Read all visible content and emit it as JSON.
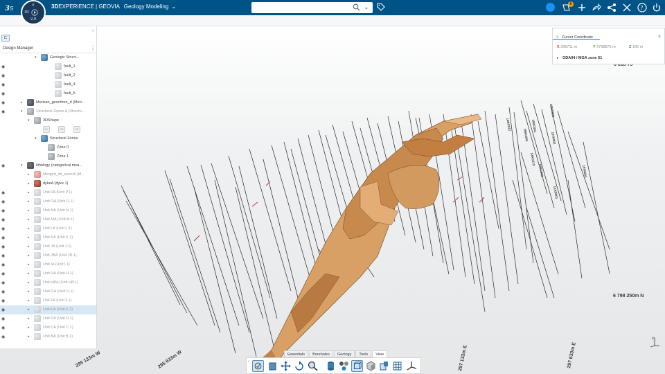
{
  "topbar": {
    "brand_bold": "3D",
    "brand_rest": "EXPERIENCE | GEOVIA",
    "app_name": "Geology Modeling",
    "compass_labels": {
      "north": "V",
      "three_d": "3D",
      "version": "V,R"
    },
    "notification_count": "6",
    "search_placeholder": ""
  },
  "design_manager": {
    "title": "Design Manager",
    "tree": [
      {
        "label": "Geologic Struct...",
        "indent": 2,
        "icon": "blue",
        "eye": false,
        "twisty": "open"
      },
      {
        "label": "fault_1",
        "indent": 4,
        "icon": "faint",
        "eye": true,
        "twisty": ""
      },
      {
        "label": "fault_2",
        "indent": 4,
        "icon": "faint",
        "eye": true,
        "twisty": ""
      },
      {
        "label": "fault_4",
        "indent": 4,
        "icon": "faint",
        "eye": true,
        "twisty": ""
      },
      {
        "label": "fault_5",
        "indent": 4,
        "icon": "faint",
        "eye": true,
        "twisty": ""
      },
      {
        "label": "Merikan_geochron_d (Meri...",
        "indent": 0,
        "icon": "dark",
        "eye": true,
        "twisty": "closed"
      },
      {
        "label": "Structural Zones A (Structu...",
        "indent": 0,
        "icon": "cube",
        "eye": true,
        "twisty": "open",
        "dim": true
      },
      {
        "label": "3DShape",
        "indent": 1,
        "icon": "cube",
        "eye": false,
        "twisty": "open"
      },
      {
        "label": "",
        "indent": 2,
        "icon": "row3",
        "eye": false,
        "twisty": "",
        "triplet": [
          "XY",
          "XZ",
          "ZX"
        ]
      },
      {
        "label": "Structural Zones",
        "indent": 2,
        "icon": "blue",
        "eye": false,
        "twisty": "open"
      },
      {
        "label": "Zone 0",
        "indent": 3,
        "icon": "cube",
        "eye": false,
        "twisty": ""
      },
      {
        "label": "Zone 1",
        "indent": 3,
        "icon": "cube",
        "eye": false,
        "twisty": ""
      },
      {
        "label": "lithology (categorical mea...",
        "indent": 0,
        "icon": "dark",
        "eye": true,
        "twisty": "open"
      },
      {
        "label": "Merged_ml_eventA (M...",
        "indent": 1,
        "icon": "pink",
        "eye": false,
        "twisty": "closed",
        "dim": true
      },
      {
        "label": "dykeA (dyke.1)",
        "indent": 1,
        "icon": "red",
        "eye": false,
        "twisty": "closed"
      },
      {
        "label": "Unit PA (Unit P.1)",
        "indent": 1,
        "icon": "faint",
        "eye": true,
        "twisty": "closed",
        "dim": true
      },
      {
        "label": "Unit OA (Unit O.1)",
        "indent": 1,
        "icon": "faint",
        "eye": true,
        "twisty": "closed",
        "dim": true
      },
      {
        "label": "Unit NA (Unit N.1)",
        "indent": 1,
        "icon": "faint",
        "eye": true,
        "twisty": "closed",
        "dim": true
      },
      {
        "label": "Unit MA (Unit M.1)",
        "indent": 1,
        "icon": "faint",
        "eye": true,
        "twisty": "closed",
        "dim": true
      },
      {
        "label": "Unit LA (Unit L.1)",
        "indent": 1,
        "icon": "faint",
        "eye": true,
        "twisty": "closed",
        "dim": true
      },
      {
        "label": "Unit KA (Unit K.1)",
        "indent": 1,
        "icon": "faint",
        "eye": true,
        "twisty": "closed",
        "dim": true
      },
      {
        "label": "Unit JA (Unit J.1)",
        "indent": 1,
        "icon": "faint",
        "eye": true,
        "twisty": "closed",
        "dim": true
      },
      {
        "label": "Unit JBA (Unit JB.1)",
        "indent": 1,
        "icon": "faint",
        "eye": true,
        "twisty": "closed",
        "dim": true
      },
      {
        "label": "Unit IA (Unit I.1)",
        "indent": 1,
        "icon": "faint",
        "eye": true,
        "twisty": "closed",
        "dim": true
      },
      {
        "label": "Unit HA (Unit H.1)",
        "indent": 1,
        "icon": "faint",
        "eye": true,
        "twisty": "closed",
        "dim": true
      },
      {
        "label": "Unit HBA (Unit HB.1)",
        "indent": 1,
        "icon": "faint",
        "eye": true,
        "twisty": "closed",
        "dim": true
      },
      {
        "label": "Unit GA (Unit G.1)",
        "indent": 1,
        "icon": "faint",
        "eye": true,
        "twisty": "closed",
        "dim": true
      },
      {
        "label": "Unit FA (Unit F.1)",
        "indent": 1,
        "icon": "faint",
        "eye": true,
        "twisty": "closed",
        "dim": true
      },
      {
        "label": "Unit EA (Unit E.1)",
        "indent": 1,
        "icon": "faint",
        "eye": true,
        "twisty": "closed",
        "dim": true,
        "selected": true
      },
      {
        "label": "Unit DA (Unit D.1)",
        "indent": 1,
        "icon": "faint",
        "eye": true,
        "twisty": "closed",
        "dim": true
      },
      {
        "label": "Unit CA (Unit C.1)",
        "indent": 1,
        "icon": "faint",
        "eye": true,
        "twisty": "closed",
        "dim": true
      },
      {
        "label": "Unit BA (Unit B.1)",
        "indent": 1,
        "icon": "faint",
        "eye": true,
        "twisty": "closed",
        "dim": true
      }
    ]
  },
  "cursor_coordinate": {
    "title": "Cursor Coordinate",
    "x_label": "X",
    "x_value": "296711 m",
    "y_label": "Y",
    "y_value": "6798873 m",
    "z_label": "Z",
    "z_value": "196 m",
    "crs": "GDA94 / MGA zone 51"
  },
  "viewport": {
    "grid_labels": {
      "n_top": "6 818 75",
      "n_mid": "6 798 250m N",
      "e1": "295 133m W",
      "e2": "295 633m W",
      "e3": "297 133m E",
      "e4": "297 633m E"
    },
    "triad_label": "x",
    "hole_labels": [
      "15TA001",
      "15RC001",
      "12RC008",
      "12AD001",
      "15RC003",
      "15RC005",
      "14RC012",
      "15TA002",
      "12RC013"
    ]
  },
  "bottom_tabs": {
    "items": [
      "Essentials",
      "Boreholes",
      "Geology",
      "Tools",
      "View"
    ],
    "active": "View"
  },
  "colors": {
    "topbar": "#005386",
    "orebody": "#d9a066",
    "orebody_shade": "#a8703c",
    "accent": "#1e8ef4"
  }
}
